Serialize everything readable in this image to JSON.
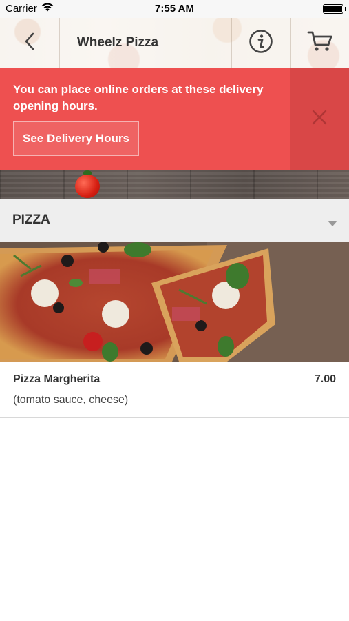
{
  "status_bar": {
    "carrier": "Carrier",
    "time": "7:55 AM",
    "battery_level": 1.0
  },
  "header": {
    "title": "Wheelz Pizza"
  },
  "notice": {
    "message": "You can place online orders at these delivery opening hours.",
    "button_label": "See Delivery Hours"
  },
  "section": {
    "title": "PIZZA"
  },
  "item": {
    "name": "Pizza Margherita",
    "price": "7.00",
    "description": "(tomato sauce, cheese)"
  },
  "colors": {
    "notice_bg": "#ee5050",
    "notice_close_bg": "#d94747",
    "section_bg": "#eeeeee"
  },
  "icons": {
    "back": "chevron-left-icon",
    "info": "info-icon",
    "cart": "cart-icon",
    "close": "close-icon",
    "section_toggle": "caret-down-icon"
  }
}
